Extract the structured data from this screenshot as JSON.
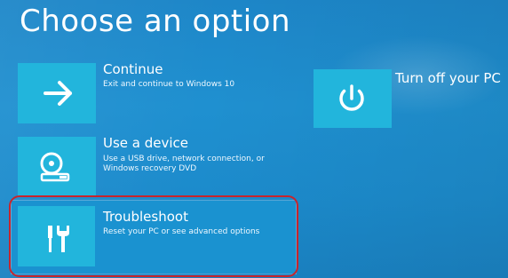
{
  "page": {
    "title": "Choose an option"
  },
  "options": {
    "continue": {
      "title": "Continue",
      "description": "Exit and continue to Windows 10",
      "icon": "arrow-right-icon"
    },
    "use_device": {
      "title": "Use a device",
      "description": "Use a USB drive, network connection, or Windows recovery DVD",
      "icon": "disc-drive-icon"
    },
    "troubleshoot": {
      "title": "Troubleshoot",
      "description": "Reset your PC or see advanced options",
      "icon": "tools-icon"
    },
    "turn_off": {
      "title": "Turn off your PC",
      "icon": "power-icon"
    }
  },
  "colors": {
    "background": "#1c8bcc",
    "tile": "#22b5dc",
    "highlight_ring": "#c8242c"
  }
}
